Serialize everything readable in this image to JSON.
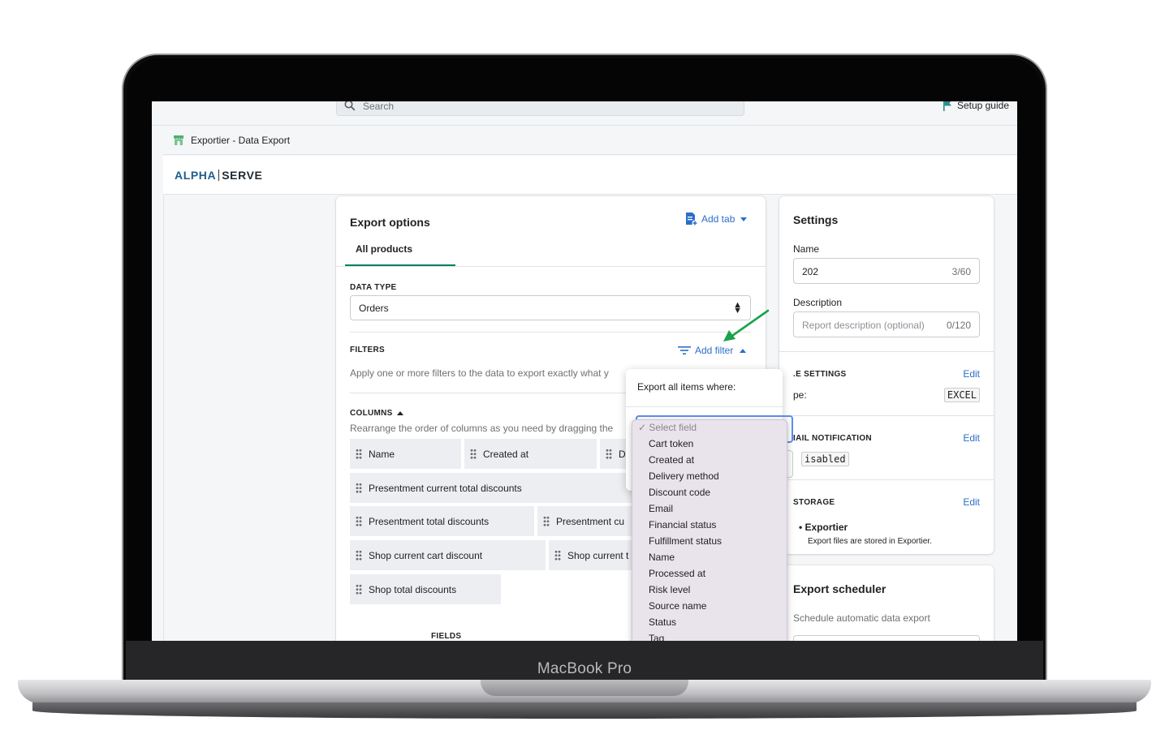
{
  "device": {
    "brand": "MacBook Pro"
  },
  "topbar": {
    "search_placeholder": "Search",
    "setup_guide": "Setup guide"
  },
  "app": {
    "title": "Exportier - Data Export",
    "logo_left": "ALPHA",
    "logo_right": "SERVE"
  },
  "export_options": {
    "title": "Export options",
    "add_tab": "Add tab",
    "tab_active": "All products",
    "data_type_label": "DATA TYPE",
    "data_type_value": "Orders",
    "filters_label": "FILTERS",
    "add_filter": "Add filter",
    "filters_hint": "Apply one or more filters to the data to export exactly what y",
    "columns_label": "COLUMNS",
    "columns_hint": "Rearrange the order of columns as you need by dragging the",
    "columns": [
      "Name",
      "Created at",
      "D",
      "Presentment current total discounts",
      "Presentment total discounts",
      "Presentment cu",
      "Shop current cart discount",
      "Shop current t",
      "Shop total discounts"
    ],
    "fields_label": "FIELDS"
  },
  "settings": {
    "title": "Settings",
    "name_label": "Name",
    "name_value": "202",
    "name_count": "3/60",
    "description_label": "Description",
    "description_placeholder": "Report description (optional)",
    "description_count": "0/120",
    "file_settings_label": ".E SETTINGS",
    "file_type_label": "pe:",
    "file_type_value": "EXCEL",
    "email_label": "IAIL NOTIFICATION",
    "email_value": "isabled",
    "storage_label": "STORAGE",
    "storage_item": "Exportier",
    "storage_sub": "Export files are stored in Exportier.",
    "edit": "Edit"
  },
  "scheduler": {
    "title": "Export scheduler",
    "hint": "Schedule automatic data export"
  },
  "filter_popover": {
    "title": "Export all items where:",
    "options": [
      "✓ Select field",
      "Cart token",
      "Created at",
      "Delivery method",
      "Discount code",
      "Email",
      "Financial status",
      "Fulfillment status",
      "Name",
      "Processed at",
      "Risk level",
      "Source name",
      "Status",
      "Tag"
    ]
  },
  "colors": {
    "accent": "#2c6ecb",
    "tab_underline": "#008060",
    "arrow": "#1aa34a"
  }
}
